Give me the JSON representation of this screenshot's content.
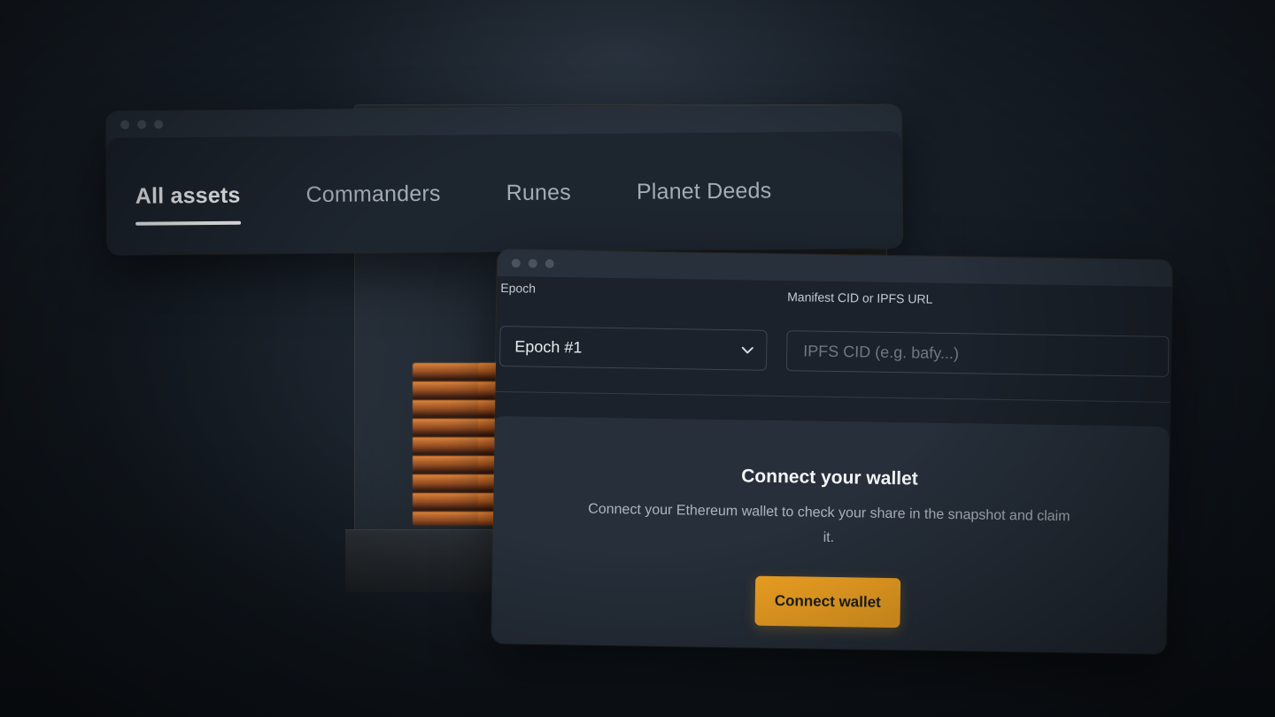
{
  "tabs_window": {
    "tabs": [
      {
        "label": "All assets",
        "active": true
      },
      {
        "label": "Commanders",
        "active": false
      },
      {
        "label": "Runes",
        "active": false
      },
      {
        "label": "Planet Deeds",
        "active": false
      }
    ]
  },
  "claim_window": {
    "epoch": {
      "label": "Epoch",
      "selected": "Epoch #1"
    },
    "manifest": {
      "label": "Manifest CID or IPFS URL",
      "placeholder": "IPFS CID (e.g. bafy...)",
      "value": ""
    },
    "wallet_card": {
      "title": "Connect your wallet",
      "description": "Connect your Ethereum wallet to check your share in the snapshot and claim it.",
      "button_label": "Connect wallet"
    }
  },
  "colors": {
    "accent": "#f6a623",
    "background": "#131a22",
    "window": "#232c37"
  }
}
